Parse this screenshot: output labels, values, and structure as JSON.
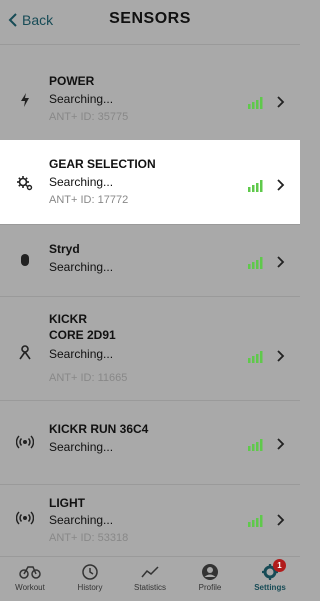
{
  "header": {
    "back_label": "Back",
    "title": "SENSORS"
  },
  "colors": {
    "accent": "#174b56",
    "signal_green": "#5fc94b",
    "badge_red": "#b11b1b",
    "highlight": "#ffffff"
  },
  "sensors": [
    {
      "name": "POWER",
      "status": "Searching...",
      "ant": "ANT+ ID: 35775",
      "icon": "lightning-icon",
      "signal": 4
    },
    {
      "name": "GEAR SELECTION",
      "status": "Searching...",
      "ant": "ANT+ ID: 17772",
      "icon": "gear-icon",
      "signal": 4,
      "highlighted": true
    },
    {
      "name": "Stryd",
      "status": "Searching...",
      "icon": "footpod-icon",
      "signal": 4
    },
    {
      "name": "KICKR\nCORE 2D91",
      "name_line1": "KICKR",
      "name_line2": "CORE 2D91",
      "status": "Searching...",
      "ant": "ANT+ ID: 11665",
      "icon": "trainer-icon",
      "signal": 4
    },
    {
      "name": "KICKR RUN 36C4",
      "status": "Searching...",
      "icon": "broadcast-icon",
      "signal": 4
    },
    {
      "name": "LIGHT",
      "status": "Searching...",
      "ant": "ANT+ ID: 53318",
      "icon": "broadcast-icon",
      "signal": 4
    }
  ],
  "tabs": [
    {
      "label": "Workout",
      "icon": "bike-icon"
    },
    {
      "label": "History",
      "icon": "history-icon"
    },
    {
      "label": "Statistics",
      "icon": "chart-icon"
    },
    {
      "label": "Profile",
      "icon": "profile-icon"
    },
    {
      "label": "Settings",
      "icon": "gear-icon",
      "active": true,
      "badge": "1"
    }
  ]
}
